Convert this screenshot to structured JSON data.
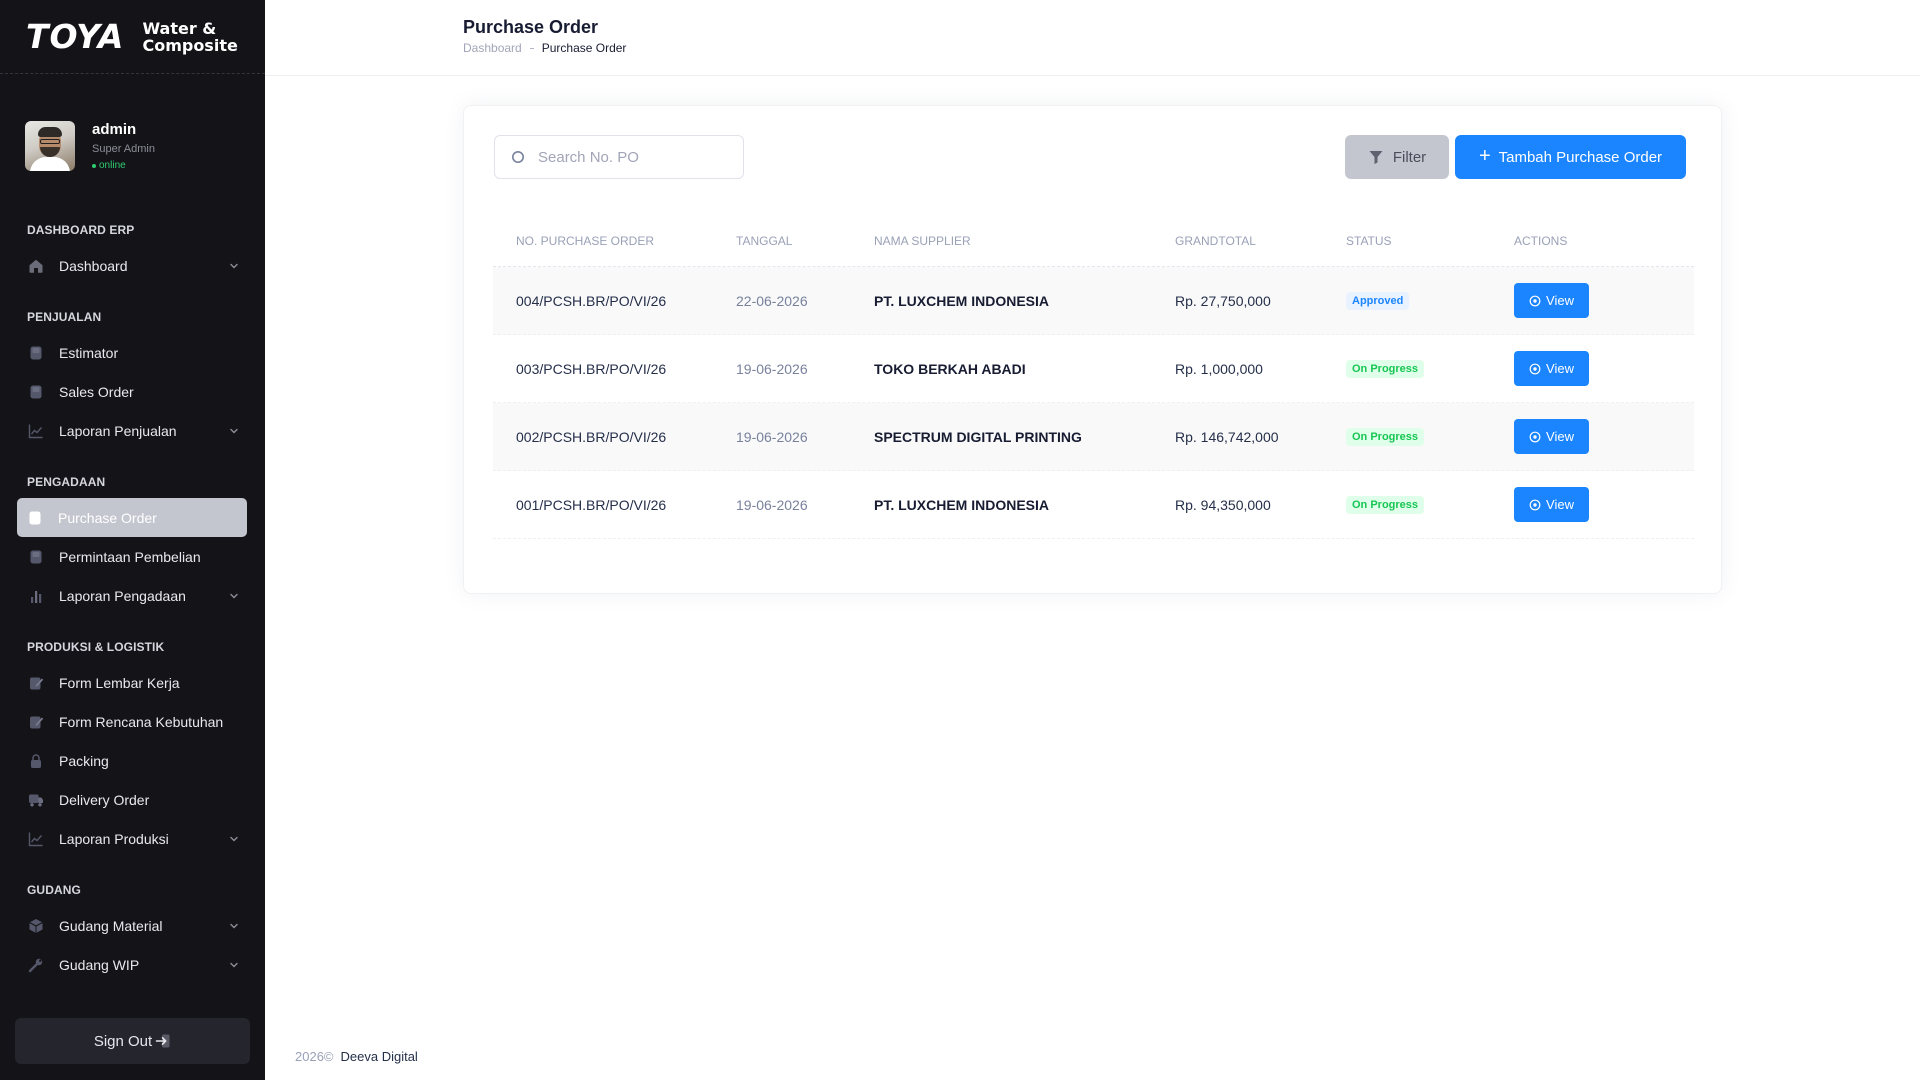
{
  "brand": {
    "name": "TOYA",
    "tagline_1": "Water &",
    "tagline_2": "Composite"
  },
  "user": {
    "name": "admin",
    "role": "Super Admin",
    "status": "online",
    "status_color": "#2ecc71"
  },
  "sidebar": {
    "sections": [
      {
        "title": "DASHBOARD ERP",
        "items": [
          {
            "label": "Dashboard",
            "icon": "home-icon",
            "has_submenu": true
          }
        ]
      },
      {
        "title": "PENJUALAN",
        "items": [
          {
            "label": "Estimator",
            "icon": "document-icon",
            "has_submenu": false
          },
          {
            "label": "Sales Order",
            "icon": "document-icon",
            "has_submenu": false
          },
          {
            "label": "Laporan Penjualan",
            "icon": "line-chart-icon",
            "has_submenu": true
          }
        ]
      },
      {
        "title": "PENGADAAN",
        "items": [
          {
            "label": "Purchase Order",
            "icon": "document-icon",
            "has_submenu": false,
            "active": true
          },
          {
            "label": "Permintaan Pembelian",
            "icon": "document-icon",
            "has_submenu": false
          },
          {
            "label": "Laporan Pengadaan",
            "icon": "bar-chart-icon",
            "has_submenu": true
          }
        ]
      },
      {
        "title": "PRODUKSI & LOGISTIK",
        "items": [
          {
            "label": "Form Lembar Kerja",
            "icon": "edit-doc-icon",
            "has_submenu": false
          },
          {
            "label": "Form Rencana Kebutuhan",
            "icon": "edit-doc-icon",
            "has_submenu": false
          },
          {
            "label": "Packing",
            "icon": "lock-icon",
            "has_submenu": false
          },
          {
            "label": "Delivery Order",
            "icon": "truck-icon",
            "has_submenu": false
          },
          {
            "label": "Laporan Produksi",
            "icon": "line-chart-icon",
            "has_submenu": true
          }
        ]
      },
      {
        "title": "GUDANG",
        "items": [
          {
            "label": "Gudang Material",
            "icon": "cube-icon",
            "has_submenu": true
          },
          {
            "label": "Gudang WIP",
            "icon": "wrench-icon",
            "has_submenu": true
          }
        ]
      }
    ],
    "signout_label": "Sign Out"
  },
  "header": {
    "title": "Purchase Order",
    "breadcrumb_parent": "Dashboard",
    "breadcrumb_current": "Purchase Order"
  },
  "toolbar": {
    "search_placeholder": "Search No. PO",
    "search_value": "",
    "filter_label": "Filter",
    "add_label": "Tambah Purchase Order"
  },
  "table": {
    "columns": [
      "NO. PURCHASE ORDER",
      "TANGGAL",
      "NAMA SUPPLIER",
      "GRANDTOTAL",
      "STATUS",
      "ACTIONS"
    ],
    "rows": [
      {
        "no": "004/PCSH.BR/PO/VI/26",
        "tanggal": "22-06-2026",
        "supplier": "PT. LUXCHEM INDONESIA",
        "total": "Rp. 27,750,000",
        "status": "Approved",
        "status_type": "approved",
        "action": "View"
      },
      {
        "no": "003/PCSH.BR/PO/VI/26",
        "tanggal": "19-06-2026",
        "supplier": "TOKO BERKAH ABADI",
        "total": "Rp. 1,000,000",
        "status": "On Progress",
        "status_type": "progress",
        "action": "View"
      },
      {
        "no": "002/PCSH.BR/PO/VI/26",
        "tanggal": "19-06-2026",
        "supplier": "SPECTRUM DIGITAL PRINTING",
        "total": "Rp. 146,742,000",
        "status": "On Progress",
        "status_type": "progress",
        "action": "View"
      },
      {
        "no": "001/PCSH.BR/PO/VI/26",
        "tanggal": "19-06-2026",
        "supplier": "PT. LUXCHEM INDONESIA",
        "total": "Rp. 94,350,000",
        "status": "On Progress",
        "status_type": "progress",
        "action": "View"
      }
    ]
  },
  "footer": {
    "year": "2026©",
    "company": "Deeva Digital"
  },
  "colors": {
    "primary": "#1b84ff",
    "sidebar_bg": "#141418",
    "approved": "#1b84ff",
    "progress": "#17c653"
  }
}
